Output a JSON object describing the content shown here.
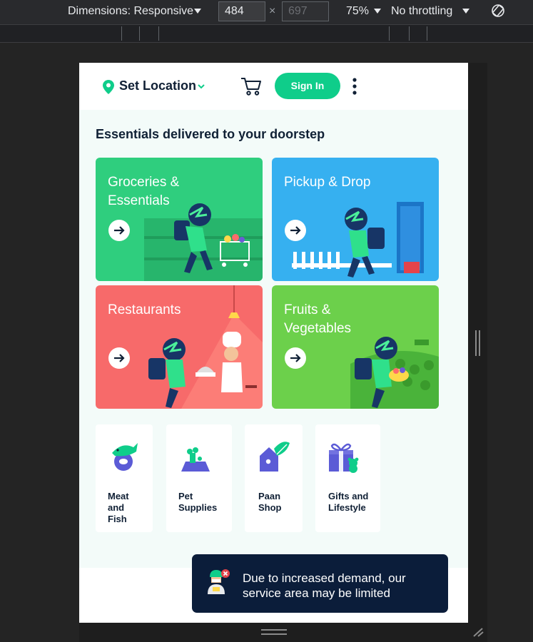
{
  "devtools": {
    "dimensions_label": "Dimensions: Responsive",
    "width_value": "484",
    "height_value": "697",
    "zoom": "75%",
    "throttling": "No throttling"
  },
  "header": {
    "location_label": "Set Location",
    "signin_label": "Sign In"
  },
  "main": {
    "headline": "Essentials delivered to your doorstep",
    "tiles": [
      {
        "label": "Groceries & Essentials",
        "color": "#2fce7e"
      },
      {
        "label": "Pickup & Drop",
        "color": "#36b0f0"
      },
      {
        "label": "Restaurants",
        "color": "#f76a6a"
      },
      {
        "label": "Fruits & Vegetables",
        "color": "#6cd04b"
      }
    ],
    "categories": [
      {
        "label": "Meat and Fish",
        "icon": "fish-icon"
      },
      {
        "label": "Pet Supplies",
        "icon": "pet-bowl-icon"
      },
      {
        "label": "Paan Shop",
        "icon": "paan-shop-icon"
      },
      {
        "label": "Gifts and Lifestyle",
        "icon": "gift-icon"
      }
    ]
  },
  "toast": {
    "message": "Due to increased demand, our service area may be limited"
  },
  "colors": {
    "brand": "#0fcd8a",
    "navy": "#0b1d3a",
    "category_icon": "#5b5bd6"
  }
}
